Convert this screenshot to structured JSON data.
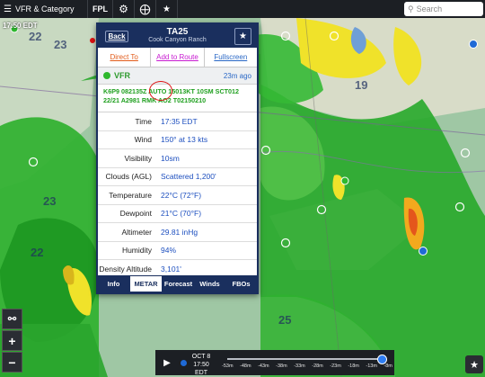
{
  "toolbar": {
    "layers_label": "VFR & Category",
    "fpl_label": "FPL",
    "icons": [
      "layers-icon",
      "gear-icon",
      "compass-icon",
      "star-clock-icon"
    ],
    "search_placeholder": "Search"
  },
  "map": {
    "time_label": "17:50 EDT"
  },
  "popup": {
    "back_label": "Back",
    "ident": "TA25",
    "name": "Cook Canyon Ranch",
    "actions": {
      "direct_to": "Direct To",
      "add_to_route": "Add to Route",
      "fullscreen": "Fullscreen"
    },
    "status": {
      "category": "VFR",
      "age": "23m ago"
    },
    "raw_metar": {
      "line1": "K6P9 082135Z AUTO 15013KT 10SM SCT012",
      "line2": "22/21 A2981 RMK AO2 T02150210"
    },
    "fields": [
      {
        "label": "Time",
        "value": "17:35 EDT"
      },
      {
        "label": "Wind",
        "value": "150° at 13 kts"
      },
      {
        "label": "Visibility",
        "value": "10sm"
      },
      {
        "label": "Clouds (AGL)",
        "value": "Scattered 1,200'"
      },
      {
        "label": "Temperature",
        "value": "22°C (72°F)"
      },
      {
        "label": "Dewpoint",
        "value": "21°C (70°F)"
      },
      {
        "label": "Altimeter",
        "value": "29.81 inHg"
      },
      {
        "label": "Humidity",
        "value": "94%"
      },
      {
        "label": "Density Altitude",
        "value": "3,101'"
      }
    ],
    "tabs": [
      {
        "label": "Info",
        "active": false
      },
      {
        "label": "METAR",
        "active": true
      },
      {
        "label": "Forecast",
        "active": false
      },
      {
        "label": "Winds",
        "active": false
      },
      {
        "label": "FBOs",
        "active": false
      }
    ]
  },
  "controls": {
    "route_icon": "route-icon",
    "zoom_in": "+",
    "zoom_out": "−"
  },
  "timeline": {
    "date_line1": "OCT 8",
    "date_line2": "17:50 EDT",
    "ticks": [
      "-53m",
      "-48m",
      "-43m",
      "-38m",
      "-33m",
      "-28m",
      "-23m",
      "-18m",
      "-13m",
      "-8m"
    ]
  }
}
